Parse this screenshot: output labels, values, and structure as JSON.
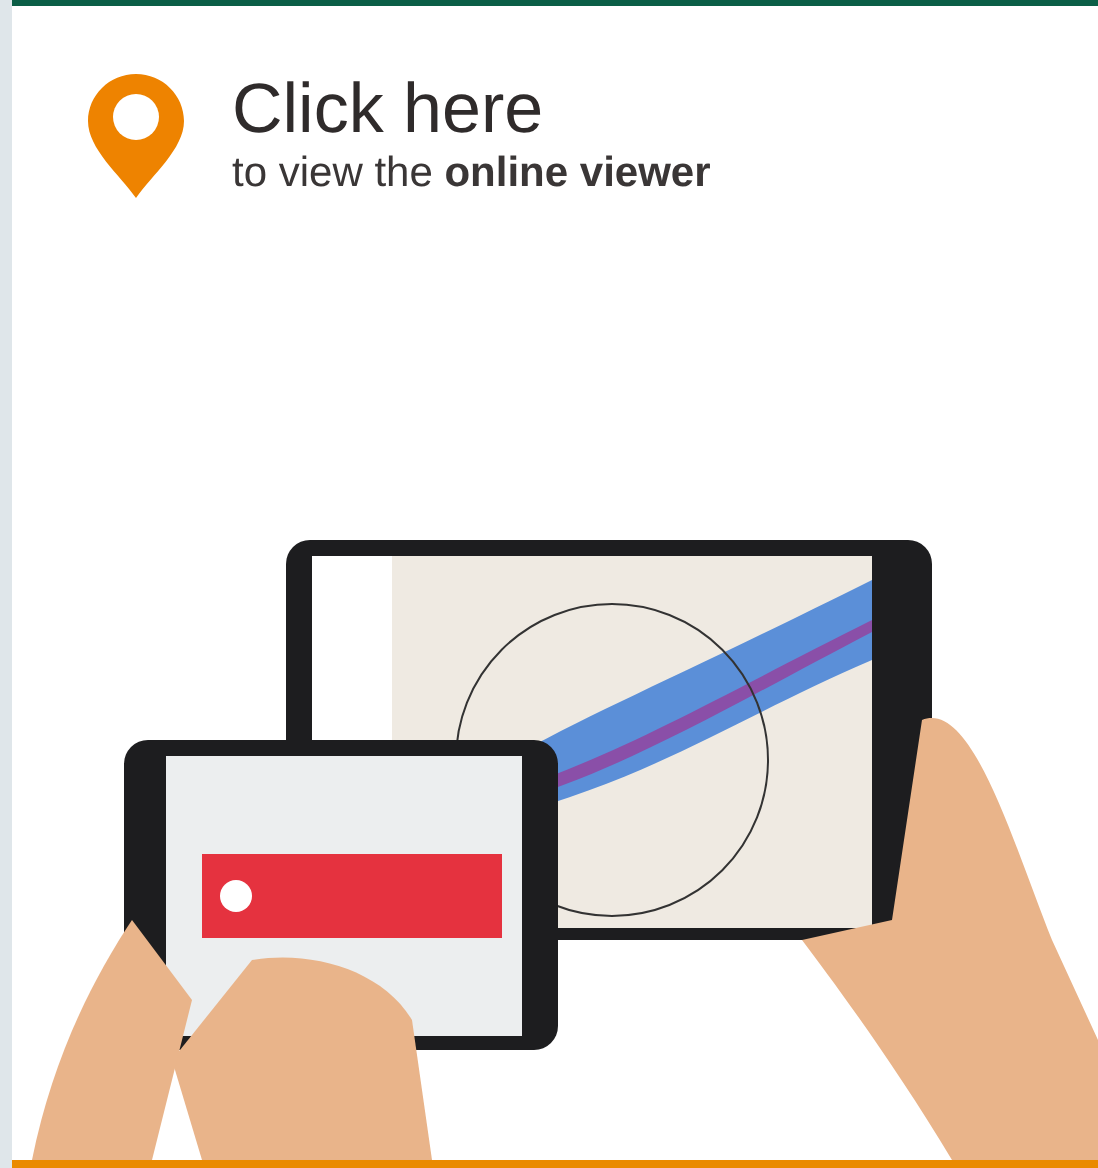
{
  "link": {
    "title": "Click here",
    "subtitle": "to view the **online viewer**"
  }
}
